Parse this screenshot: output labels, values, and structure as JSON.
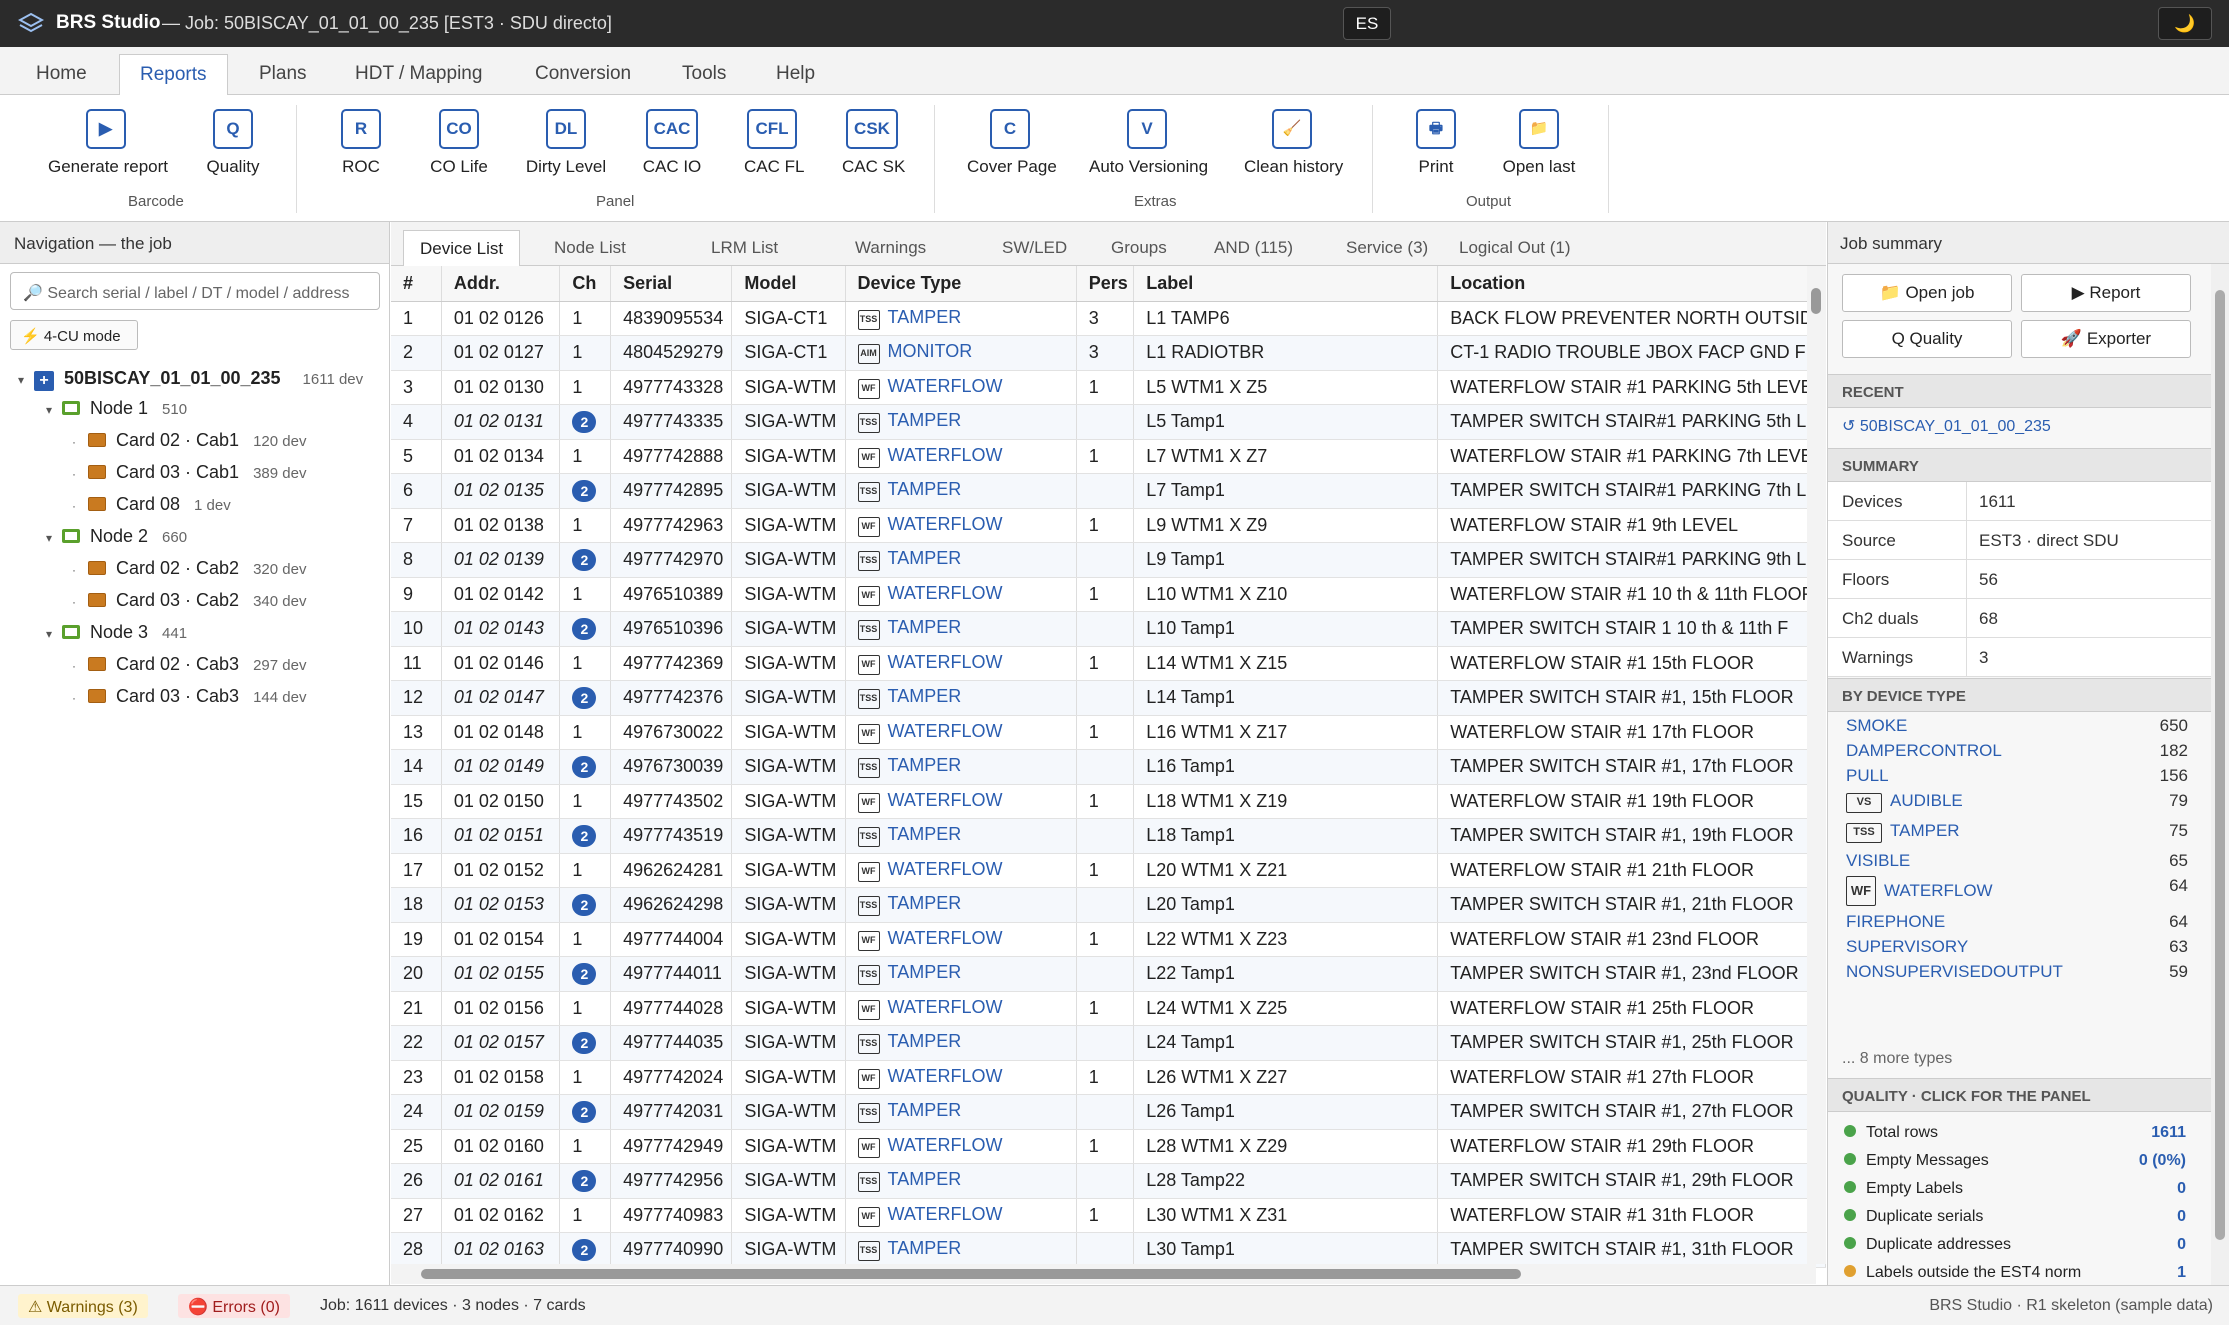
{
  "app": {
    "title": "BRS Studio",
    "job": "— Job: 50BISCAY_01_01_00_235 [EST3 · SDU directo]",
    "lang": "ES",
    "theme_icon": "moon-icon"
  },
  "menu": [
    "Home",
    "Reports",
    "Plans",
    "HDT / Mapping",
    "Conversion",
    "Tools",
    "Help"
  ],
  "ribbon": {
    "buttons": [
      {
        "icon": "▶",
        "label": "Generate report"
      },
      {
        "icon": "Q",
        "label": "Quality"
      },
      {
        "icon": "R",
        "label": "ROC"
      },
      {
        "icon": "CO",
        "label": "CO Life"
      },
      {
        "icon": "DL",
        "label": "Dirty Level"
      },
      {
        "icon": "CAC",
        "label": "CAC IO"
      },
      {
        "icon": "CFL",
        "label": "CAC FL"
      },
      {
        "icon": "CSK",
        "label": "CAC SK"
      },
      {
        "icon": "C",
        "label": "Cover Page"
      },
      {
        "icon": "V",
        "label": "Auto Versioning"
      },
      {
        "icon": "🧹",
        "label": "Clean history"
      },
      {
        "icon": "🖶",
        "label": "Print"
      },
      {
        "icon": "📁",
        "label": "Open last"
      }
    ],
    "groups": [
      "Barcode",
      "Panel",
      "Extras",
      "Output"
    ]
  },
  "nav": {
    "header": "Navigation — the job",
    "search_placeholder": "Search serial / label / DT / model / address",
    "mode": "⚡ 4-CU mode",
    "tree": [
      {
        "label": "50BISCAY_01_01_00_235",
        "count": "1611 dev"
      },
      {
        "label": "Node 1",
        "count": "510"
      },
      {
        "label": "Card 02 · Cab1",
        "count": "120 dev"
      },
      {
        "label": "Card 03 · Cab1",
        "count": "389 dev"
      },
      {
        "label": "Card 08",
        "count": "1 dev"
      },
      {
        "label": "Node 2",
        "count": "660"
      },
      {
        "label": "Card 02 · Cab2",
        "count": "320 dev"
      },
      {
        "label": "Card 03 · Cab2",
        "count": "340 dev"
      },
      {
        "label": "Node 3",
        "count": "441"
      },
      {
        "label": "Card 02 · Cab3",
        "count": "297 dev"
      },
      {
        "label": "Card 03 · Cab3",
        "count": "144 dev"
      }
    ]
  },
  "tabs": [
    "Device List",
    "Node List",
    "LRM List",
    "Warnings",
    "SW/LED",
    "Groups",
    "AND (115)",
    "Service (3)",
    "Logical Out (1)"
  ],
  "table": {
    "headers": [
      "#",
      "Addr.",
      "Ch",
      "Serial",
      "Model",
      "Device Type",
      "Pers",
      "Label",
      "Location"
    ],
    "rows": [
      [
        "1",
        "01 02 0126",
        "1",
        "4839095534",
        "SIGA-CT1",
        "TSS",
        "TAMPER",
        "3",
        "L1 TAMP6",
        "BACK FLOW PREVENTER NORTH OUTSIDE"
      ],
      [
        "2",
        "01 02 0127",
        "1",
        "4804529279",
        "SIGA-CT1",
        "AIM",
        "MONITOR",
        "3",
        "L1 RADIOTBR",
        "CT-1 RADIO TROUBLE JBOX FACP GND FL"
      ],
      [
        "3",
        "01 02 0130",
        "1",
        "4977743328",
        "SIGA-WTM",
        "WF",
        "WATERFLOW",
        "1",
        "L5 WTM1 X Z5",
        "WATERFLOW STAIR #1 PARKING 5th LEVEL"
      ],
      [
        "4",
        "01 02 0131",
        "2",
        "4977743335",
        "SIGA-WTM",
        "TSS",
        "TAMPER",
        "",
        "L5 Tamp1",
        "TAMPER SWITCH STAIR#1 PARKING 5th L"
      ],
      [
        "5",
        "01 02 0134",
        "1",
        "4977742888",
        "SIGA-WTM",
        "WF",
        "WATERFLOW",
        "1",
        "L7 WTM1 X Z7",
        "WATERFLOW STAIR #1 PARKING 7th LEVEL"
      ],
      [
        "6",
        "01 02 0135",
        "2",
        "4977742895",
        "SIGA-WTM",
        "TSS",
        "TAMPER",
        "",
        "L7 Tamp1",
        "TAMPER SWITCH STAIR#1 PARKING 7th L"
      ],
      [
        "7",
        "01 02 0138",
        "1",
        "4977742963",
        "SIGA-WTM",
        "WF",
        "WATERFLOW",
        "1",
        "L9 WTM1 X Z9",
        "WATERFLOW STAIR #1 9th LEVEL"
      ],
      [
        "8",
        "01 02 0139",
        "2",
        "4977742970",
        "SIGA-WTM",
        "TSS",
        "TAMPER",
        "",
        "L9 Tamp1",
        "TAMPER SWITCH STAIR#1 PARKING 9th L"
      ],
      [
        "9",
        "01 02 0142",
        "1",
        "4976510389",
        "SIGA-WTM",
        "WF",
        "WATERFLOW",
        "1",
        "L10 WTM1 X Z10",
        "WATERFLOW STAIR #1 10 th & 11th FLOOR"
      ],
      [
        "10",
        "01 02 0143",
        "2",
        "4976510396",
        "SIGA-WTM",
        "TSS",
        "TAMPER",
        "",
        "L10 Tamp1",
        "TAMPER SWITCH STAIR 1 10 th & 11th F"
      ],
      [
        "11",
        "01 02 0146",
        "1",
        "4977742369",
        "SIGA-WTM",
        "WF",
        "WATERFLOW",
        "1",
        "L14 WTM1 X Z15",
        "WATERFLOW STAIR #1 15th FLOOR"
      ],
      [
        "12",
        "01 02 0147",
        "2",
        "4977742376",
        "SIGA-WTM",
        "TSS",
        "TAMPER",
        "",
        "L14 Tamp1",
        "TAMPER SWITCH STAIR #1, 15th FLOOR"
      ],
      [
        "13",
        "01 02 0148",
        "1",
        "4976730022",
        "SIGA-WTM",
        "WF",
        "WATERFLOW",
        "1",
        "L16 WTM1 X Z17",
        "WATERFLOW STAIR #1 17th FLOOR"
      ],
      [
        "14",
        "01 02 0149",
        "2",
        "4976730039",
        "SIGA-WTM",
        "TSS",
        "TAMPER",
        "",
        "L16 Tamp1",
        "TAMPER SWITCH STAIR #1, 17th FLOOR"
      ],
      [
        "15",
        "01 02 0150",
        "1",
        "4977743502",
        "SIGA-WTM",
        "WF",
        "WATERFLOW",
        "1",
        "L18 WTM1 X Z19",
        "WATERFLOW STAIR #1 19th FLOOR"
      ],
      [
        "16",
        "01 02 0151",
        "2",
        "4977743519",
        "SIGA-WTM",
        "TSS",
        "TAMPER",
        "",
        "L18 Tamp1",
        "TAMPER SWITCH STAIR #1, 19th FLOOR"
      ],
      [
        "17",
        "01 02 0152",
        "1",
        "4962624281",
        "SIGA-WTM",
        "WF",
        "WATERFLOW",
        "1",
        "L20 WTM1 X Z21",
        "WATERFLOW STAIR #1 21th FLOOR"
      ],
      [
        "18",
        "01 02 0153",
        "2",
        "4962624298",
        "SIGA-WTM",
        "TSS",
        "TAMPER",
        "",
        "L20 Tamp1",
        "TAMPER SWITCH STAIR #1, 21th FLOOR"
      ],
      [
        "19",
        "01 02 0154",
        "1",
        "4977744004",
        "SIGA-WTM",
        "WF",
        "WATERFLOW",
        "1",
        "L22 WTM1 X Z23",
        "WATERFLOW STAIR #1 23nd FLOOR"
      ],
      [
        "20",
        "01 02 0155",
        "2",
        "4977744011",
        "SIGA-WTM",
        "TSS",
        "TAMPER",
        "",
        "L22 Tamp1",
        "TAMPER SWITCH STAIR #1, 23nd FLOOR"
      ],
      [
        "21",
        "01 02 0156",
        "1",
        "4977744028",
        "SIGA-WTM",
        "WF",
        "WATERFLOW",
        "1",
        "L24 WTM1 X Z25",
        "WATERFLOW STAIR #1 25th FLOOR"
      ],
      [
        "22",
        "01 02 0157",
        "2",
        "4977744035",
        "SIGA-WTM",
        "TSS",
        "TAMPER",
        "",
        "L24 Tamp1",
        "TAMPER SWITCH STAIR #1, 25th FLOOR"
      ],
      [
        "23",
        "01 02 0158",
        "1",
        "4977742024",
        "SIGA-WTM",
        "WF",
        "WATERFLOW",
        "1",
        "L26 WTM1 X Z27",
        "WATERFLOW STAIR #1 27th FLOOR"
      ],
      [
        "24",
        "01 02 0159",
        "2",
        "4977742031",
        "SIGA-WTM",
        "TSS",
        "TAMPER",
        "",
        "L26 Tamp1",
        "TAMPER SWITCH STAIR #1, 27th FLOOR"
      ],
      [
        "25",
        "01 02 0160",
        "1",
        "4977742949",
        "SIGA-WTM",
        "WF",
        "WATERFLOW",
        "1",
        "L28 WTM1 X Z29",
        "WATERFLOW STAIR #1 29th FLOOR"
      ],
      [
        "26",
        "01 02 0161",
        "2",
        "4977742956",
        "SIGA-WTM",
        "TSS",
        "TAMPER",
        "",
        "L28 Tamp22",
        "TAMPER SWITCH STAIR #1, 29th FLOOR"
      ],
      [
        "27",
        "01 02 0162",
        "1",
        "4977740983",
        "SIGA-WTM",
        "WF",
        "WATERFLOW",
        "1",
        "L30 WTM1 X Z31",
        "WATERFLOW STAIR #1 31th FLOOR"
      ],
      [
        "28",
        "01 02 0163",
        "2",
        "4977740990",
        "SIGA-WTM",
        "TSS",
        "TAMPER",
        "",
        "L30 Tamp1",
        "TAMPER SWITCH STAIR #1, 31th FLOOR"
      ]
    ]
  },
  "summary": {
    "header": "Job summary",
    "buttons": [
      {
        "label": "Open job",
        "icon": "folder-icon"
      },
      {
        "label": "▶ Report",
        "icon": "play-icon"
      },
      {
        "label": "Q Quality",
        "icon": "quality-icon"
      },
      {
        "label": "Exporter",
        "icon": "rocket-icon"
      }
    ],
    "recent_title": "RECENT",
    "recent_item": "↺ 50BISCAY_01_01_00_235",
    "summary_title": "SUMMARY",
    "rows": [
      {
        "k": "Devices",
        "v": "1611"
      },
      {
        "k": "Source",
        "v": "EST3 · direct SDU"
      },
      {
        "k": "Floors",
        "v": "56"
      },
      {
        "k": "Ch2 duals",
        "v": "68"
      },
      {
        "k": "Warnings",
        "v": "3"
      }
    ],
    "bytype_title": "BY DEVICE TYPE",
    "types": [
      {
        "badge": "",
        "name": "SMOKE",
        "count": "650"
      },
      {
        "badge": "",
        "name": "DAMPERCONTROL",
        "count": "182"
      },
      {
        "badge": "",
        "name": "PULL",
        "count": "156"
      },
      {
        "badge": "VS",
        "name": "AUDIBLE",
        "count": "79"
      },
      {
        "badge": "TSS",
        "name": "TAMPER",
        "count": "75"
      },
      {
        "badge": "",
        "name": "VISIBLE",
        "count": "65"
      },
      {
        "badge": "WF",
        "name": "WATERFLOW",
        "count": "64"
      },
      {
        "badge": "",
        "name": "FIREPHONE",
        "count": "64"
      },
      {
        "badge": "",
        "name": "SUPERVISORY",
        "count": "63"
      },
      {
        "badge": "",
        "name": "NONSUPERVISEDOUTPUT",
        "count": "59"
      }
    ],
    "more_types": "... 8 more types",
    "quality_title": "QUALITY · CLICK FOR THE PANEL",
    "quality": [
      {
        "name": "Total rows",
        "count": "1611",
        "color": "#4aa34a"
      },
      {
        "name": "Empty Messages",
        "count": "0 (0%)",
        "color": "#4aa34a"
      },
      {
        "name": "Empty Labels",
        "count": "0",
        "color": "#4aa34a"
      },
      {
        "name": "Duplicate serials",
        "count": "0",
        "color": "#4aa34a"
      },
      {
        "name": "Duplicate addresses",
        "count": "0",
        "color": "#4aa34a"
      },
      {
        "name": "Labels outside the EST4 norm",
        "count": "1",
        "color": "#e0a030"
      }
    ]
  },
  "status": {
    "warnings": "⚠ Warnings (3)",
    "errors": "⛔ Errors (0)",
    "job": "Job: 1611 devices · 3 nodes · 7 cards",
    "right": "BRS Studio · R1 skeleton (sample data)"
  }
}
